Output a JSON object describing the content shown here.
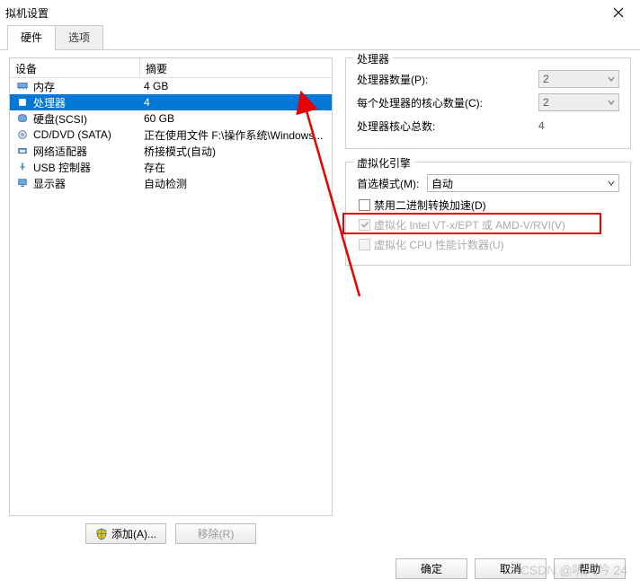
{
  "window": {
    "title": "拟机设置"
  },
  "tabs": {
    "hardware": "硬件",
    "options": "选项"
  },
  "device_table": {
    "col_device": "设备",
    "col_summary": "摘要",
    "rows": [
      {
        "name": "内存",
        "summary": "4 GB",
        "icon": "memory"
      },
      {
        "name": "处理器",
        "summary": "4",
        "icon": "cpu",
        "selected": true
      },
      {
        "name": "硬盘(SCSI)",
        "summary": "60 GB",
        "icon": "disk"
      },
      {
        "name": "CD/DVD (SATA)",
        "summary": "正在使用文件 F:\\操作系统\\Windows...",
        "icon": "cd"
      },
      {
        "name": "网络适配器",
        "summary": "桥接模式(自动)",
        "icon": "nic"
      },
      {
        "name": "USB 控制器",
        "summary": "存在",
        "icon": "usb"
      },
      {
        "name": "显示器",
        "summary": "自动检测",
        "icon": "display"
      }
    ]
  },
  "buttons": {
    "add": "添加(A)...",
    "remove": "移除(R)",
    "ok": "确定",
    "cancel": "取消",
    "help": "帮助"
  },
  "processor_group": {
    "title": "处理器",
    "num_processors_label": "处理器数量(P):",
    "num_processors_value": "2",
    "cores_per_label": "每个处理器的核心数量(C):",
    "cores_per_value": "2",
    "total_cores_label": "处理器核心总数:",
    "total_cores_value": "4"
  },
  "virt_group": {
    "title": "虚拟化引擎",
    "pref_mode_label": "首选模式(M):",
    "pref_mode_value": "自动",
    "chk_binary": "禁用二进制转换加速(D)",
    "chk_vtx": "虚拟化 Intel VT-x/EPT 或 AMD-V/RVI(V)",
    "chk_perf": "虚拟化 CPU 性能计数器(U)"
  },
  "watermark": "CSDN @听风吟     24"
}
